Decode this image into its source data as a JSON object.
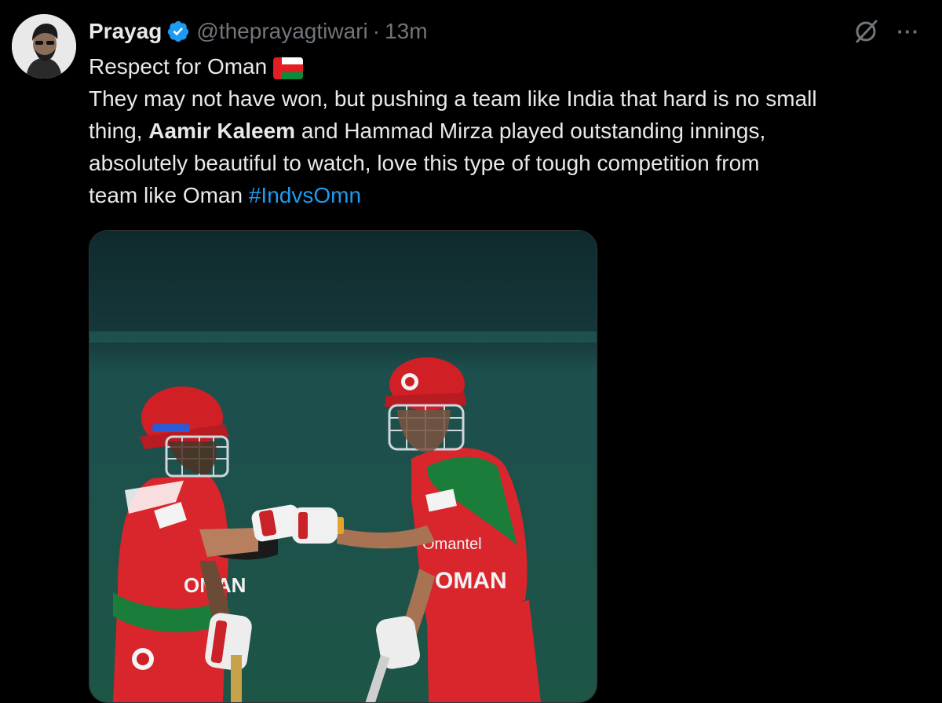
{
  "tweet": {
    "author_name": "Prayag",
    "author_handle": "@theprayagtiwari",
    "separator": "·",
    "time": "13m",
    "line1": "Respect for Oman",
    "flag_icon": "oman-flag-emoji",
    "line2": "They may not have won, but pushing a team like India that hard is no small",
    "line3_start": "thing, ",
    "line3_bold": "Aamir Kaleem",
    "line3_end": " and Hammad Mirza played outstanding innings,",
    "line4": "absolutely beautiful to watch, love this type of tough competition from",
    "line5_start": "team like Oman ",
    "hashtag": "#IndvsOmn",
    "more_glyph": "···"
  },
  "colors": {
    "background": "#000000",
    "text": "#e7e9ea",
    "muted": "#71767b",
    "link": "#1d9bf0",
    "verified": "#1d9bf0",
    "oman_red": "#e41d24",
    "oman_green": "#0b8a3b"
  },
  "icons": {
    "verified": "verified-badge-icon",
    "grok": "grok-icon",
    "more": "more-options-icon"
  },
  "media": {
    "jersey_text": "OMAN",
    "sponsor_text": "Omantel"
  }
}
